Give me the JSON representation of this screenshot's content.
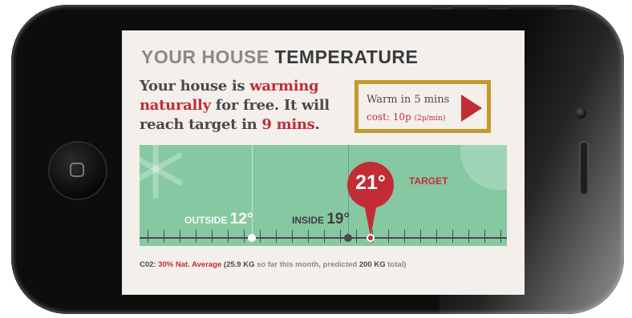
{
  "screen": {
    "title": {
      "light": "YOUR HOUSE",
      "bold": "TEMPERATURE"
    },
    "headline": {
      "p1": "Your house is ",
      "warming": "warming",
      "naturally": "naturally",
      "p2": " for free. It will reach target in ",
      "mins": "9 mins",
      "p3": "."
    },
    "cta": {
      "line1": "Warm in 5 mins",
      "cost_label": "cost: ",
      "cost_value": "10p",
      "rate": "(2p/min)"
    },
    "panel": {
      "outside_label": "OUTSIDE",
      "outside_temp": "12°",
      "inside_label": "INSIDE",
      "inside_temp": "19°",
      "target_temp": "21°",
      "target_label": "TARGET"
    },
    "footer": {
      "co2_label": "C02: ",
      "co2_pct": "30% Nat. Average",
      "open": " (",
      "amount": "25.9 KG",
      "mid": " so far this month, predicted ",
      "predicted": "200 KG",
      "end": " total)"
    }
  },
  "colors": {
    "accent_red": "#c32c35",
    "frame_gold": "#c49a2c",
    "panel_green": "#86c8a2",
    "screen_bg": "#f3efeb"
  },
  "icons": {
    "cta_arrow": "play-triangle-icon",
    "panel_deco": "snowflake-icon",
    "home": "home-square-icon"
  }
}
